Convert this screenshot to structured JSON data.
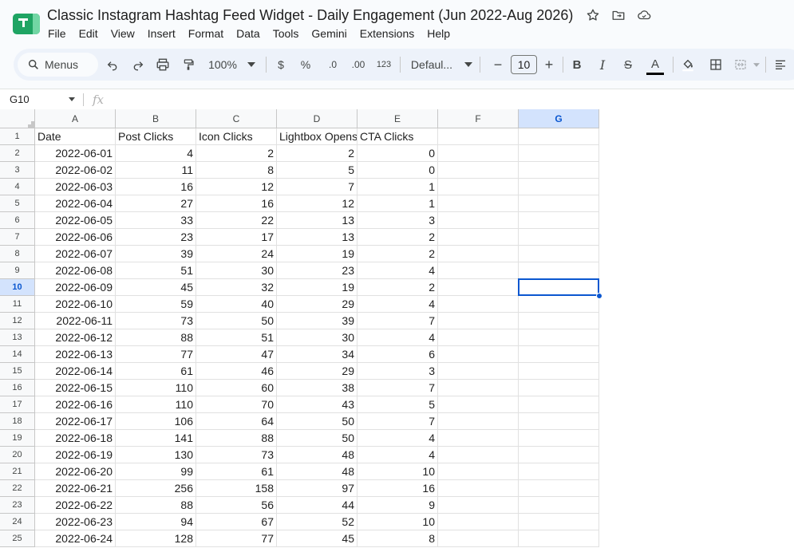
{
  "document": {
    "title": "Classic Instagram Hashtag Feed Widget - Daily Engagement (Jun 2022-Aug 2026)"
  },
  "title_icons": [
    "star-icon",
    "move-to-folder-icon",
    "cloud-saved-icon"
  ],
  "menu": [
    "File",
    "Edit",
    "View",
    "Insert",
    "Format",
    "Data",
    "Tools",
    "Gemini",
    "Extensions",
    "Help"
  ],
  "toolbar": {
    "search_label": "Menus",
    "zoom": "100%",
    "currency": "$",
    "percent": "%",
    "decrease_decimal": ".0",
    "increase_decimal": ".00",
    "number_format": "123",
    "font_family": "Defaul...",
    "font_size": "10",
    "bold": "B",
    "italic": "I",
    "strikethrough": "S",
    "text_color": "A",
    "minus": "−",
    "plus": "+"
  },
  "formula_bar": {
    "name_box": "G10",
    "fx": "fx",
    "value": ""
  },
  "colors": {
    "accent": "#0b57d0",
    "selected_header": "#d3e3fd",
    "sheets_green": "#1fa463"
  },
  "grid": {
    "columns": [
      "A",
      "B",
      "C",
      "D",
      "E",
      "F",
      "G"
    ],
    "active_column": "G",
    "active_row": "10",
    "row_numbers": [
      "1",
      "2",
      "3",
      "4",
      "5",
      "6",
      "7",
      "8",
      "9",
      "10",
      "11",
      "12",
      "13",
      "14",
      "15",
      "16",
      "17",
      "18",
      "19",
      "20",
      "21",
      "22",
      "23",
      "24",
      "25"
    ],
    "header_row": [
      "Date",
      "Post Clicks",
      "Icon Clicks",
      "Lightbox Opens",
      "CTA Clicks",
      "",
      ""
    ],
    "rows": [
      [
        "2022-06-01",
        "4",
        "2",
        "2",
        "0"
      ],
      [
        "2022-06-02",
        "11",
        "8",
        "5",
        "0"
      ],
      [
        "2022-06-03",
        "16",
        "12",
        "7",
        "1"
      ],
      [
        "2022-06-04",
        "27",
        "16",
        "12",
        "1"
      ],
      [
        "2022-06-05",
        "33",
        "22",
        "13",
        "3"
      ],
      [
        "2022-06-06",
        "23",
        "17",
        "13",
        "2"
      ],
      [
        "2022-06-07",
        "39",
        "24",
        "19",
        "2"
      ],
      [
        "2022-06-08",
        "51",
        "30",
        "23",
        "4"
      ],
      [
        "2022-06-09",
        "45",
        "32",
        "19",
        "2"
      ],
      [
        "2022-06-10",
        "59",
        "40",
        "29",
        "4"
      ],
      [
        "2022-06-11",
        "73",
        "50",
        "39",
        "7"
      ],
      [
        "2022-06-12",
        "88",
        "51",
        "30",
        "4"
      ],
      [
        "2022-06-13",
        "77",
        "47",
        "34",
        "6"
      ],
      [
        "2022-06-14",
        "61",
        "46",
        "29",
        "3"
      ],
      [
        "2022-06-15",
        "110",
        "60",
        "38",
        "7"
      ],
      [
        "2022-06-16",
        "110",
        "70",
        "43",
        "5"
      ],
      [
        "2022-06-17",
        "106",
        "64",
        "50",
        "7"
      ],
      [
        "2022-06-18",
        "141",
        "88",
        "50",
        "4"
      ],
      [
        "2022-06-19",
        "130",
        "73",
        "48",
        "4"
      ],
      [
        "2022-06-20",
        "99",
        "61",
        "48",
        "10"
      ],
      [
        "2022-06-21",
        "256",
        "158",
        "97",
        "16"
      ],
      [
        "2022-06-22",
        "88",
        "56",
        "44",
        "9"
      ],
      [
        "2022-06-23",
        "94",
        "67",
        "52",
        "10"
      ],
      [
        "2022-06-24",
        "128",
        "77",
        "45",
        "8"
      ]
    ]
  }
}
